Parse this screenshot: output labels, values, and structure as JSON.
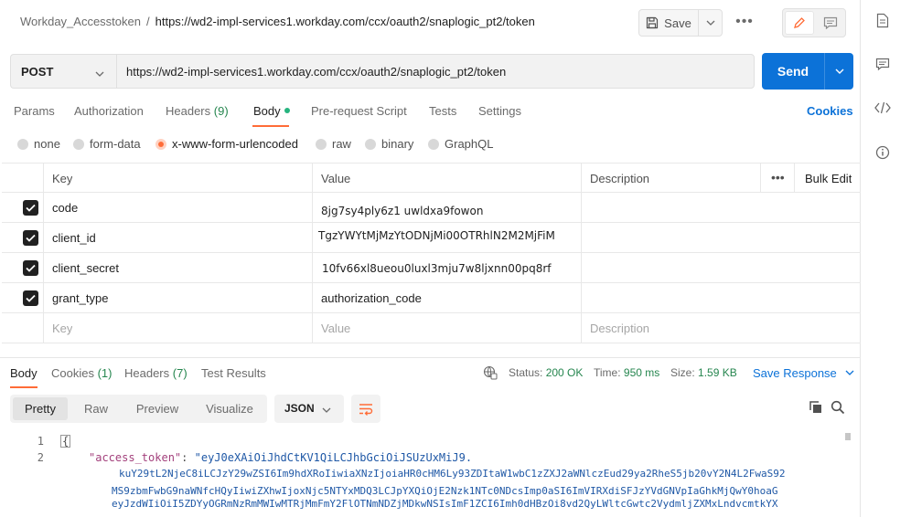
{
  "request": {
    "collection": "Workday_Accesstoken",
    "separator": "/",
    "name": "https://wd2-impl-services1.workday.com/ccx/oauth2/snaplogic_pt2/token",
    "save_label": "Save",
    "method": "POST",
    "url": "https://wd2-impl-services1.workday.com/ccx/oauth2/snaplogic_pt2/token",
    "send_label": "Send"
  },
  "request_tabs": {
    "params": "Params",
    "authorization": "Authorization",
    "headers": "Headers",
    "headers_count": "(9)",
    "body": "Body",
    "pre_request": "Pre-request Script",
    "tests": "Tests",
    "settings": "Settings",
    "cookies": "Cookies"
  },
  "body_types": {
    "none": "none",
    "form_data": "form-data",
    "urlencoded": "x-www-form-urlencoded",
    "raw": "raw",
    "binary": "binary",
    "graphql": "GraphQL",
    "selected": "x-www-form-urlencoded"
  },
  "params_table": {
    "headers": {
      "key": "Key",
      "value": "Value",
      "description": "Description",
      "bulk_edit": "Bulk Edit"
    },
    "rows": [
      {
        "key": "code",
        "value": "8jg7sy4ply6z1 uwldxa9fowon",
        "checked": true
      },
      {
        "key": "client_id",
        "value": "TgzYWYtMjMzYtODNjMi00OTRhlN2M2MjFiM",
        "checked": true
      },
      {
        "key": "client_secret",
        "value": "10fv66xl8ueou0luxl3mju7w8ljxnn00pq8rf",
        "checked": true
      },
      {
        "key": "grant_type",
        "value": "authorization_code",
        "checked": true
      }
    ],
    "placeholder": {
      "key": "Key",
      "value": "Value",
      "description": "Description"
    }
  },
  "response": {
    "tabs": {
      "body": "Body",
      "cookies": "Cookies",
      "cookies_count": "(1)",
      "headers": "Headers",
      "headers_count": "(7)",
      "test_results": "Test Results"
    },
    "status_label": "Status:",
    "status_value": "200 OK",
    "time_label": "Time:",
    "time_value": "950 ms",
    "size_label": "Size:",
    "size_value": "1.59 KB",
    "save_response": "Save Response",
    "views": [
      "Pretty",
      "Raw",
      "Preview",
      "Visualize"
    ],
    "active_view": "Pretty",
    "format": "JSON",
    "line_numbers": [
      "1",
      "2"
    ],
    "code": {
      "open_brace": "{",
      "key": "\"access_token\"",
      "colon": ":",
      "value_line1": "\"eyJ0eXAiOiJhdCtKV1QiLCJhbGciOiJSUzUxMiJ9.",
      "value_line2": "kuY29tL2NjeC8iLCJzY29wZSI6Im9hdXRoIiwiaXNzIjoiaHR0cHM6Ly93ZDItaW1wbC1zZXJ2aWNlczEud29ya2RheS5jb20vY2N4L2FwaS92",
      "value_line3": "MS9zbmFwbG9naWNfcHQyIiwiZXhwIjoxNjc5NTYxMDQ3LCJpYXQiOjE2Nzk1NTc0NDcsImp0aSI6ImVIRXdiSFJzYVdGNVpIaGhkMjQwY0hoaG",
      "value_line4": "eyJzdWIiOiI5ZDYyOGRmNzRmMWIwMTRjMmFmY2FlOTNmNDZjMDkwNSIsImF1ZCI6Imh0dHBzOi8vd2QyLWltcGwtc2VydmljZXMxLndvcmtkYX"
    }
  },
  "colors": {
    "send": "#0c72d8",
    "accent": "#ff6c37",
    "status_ok": "#26864f",
    "link": "#0c72d8"
  },
  "icons": {
    "save": "floppy-disk-icon",
    "edit": "pencil-icon",
    "doc": "comment-icon",
    "rail": [
      "document-icon",
      "comment-icon",
      "code-icon",
      "info-icon"
    ],
    "globe": "globe-icon",
    "wrap": "wrap-text-icon",
    "copy": "copy-icon",
    "search": "search-icon"
  }
}
